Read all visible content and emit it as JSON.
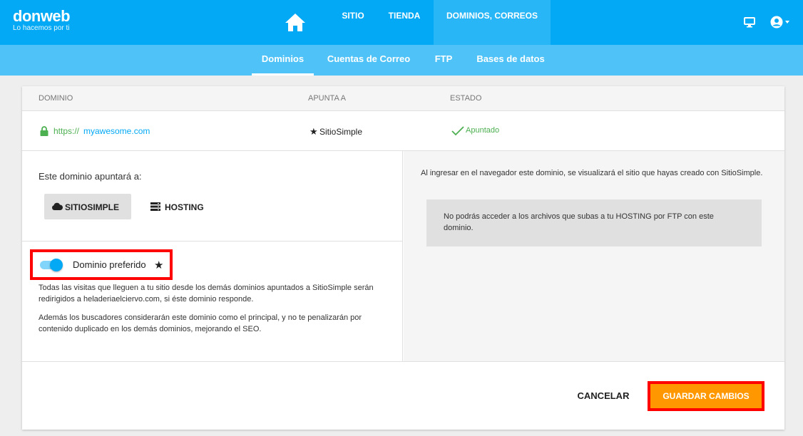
{
  "brand": {
    "name": "donweb",
    "tagline": "Lo hacemos por ti"
  },
  "nav": {
    "items": [
      {
        "label": "SITIO"
      },
      {
        "label": "TIENDA"
      },
      {
        "label": "DOMINIOS, CORREOS",
        "active": true
      }
    ],
    "icons": [
      "home-icon",
      "monitor-icon",
      "user-icon",
      "caret-down-icon"
    ]
  },
  "subnav": {
    "tabs": [
      {
        "label": "Dominios",
        "active": true
      },
      {
        "label": "Cuentas de Correo"
      },
      {
        "label": "FTP"
      },
      {
        "label": "Bases de datos"
      }
    ]
  },
  "table": {
    "headers": {
      "dominio": "DOMINIO",
      "apunta": "APUNTA A",
      "estado": "ESTADO"
    },
    "row": {
      "prefix": "https://",
      "domain": "myawesome.com",
      "apunta": "SitioSimple",
      "estado": "Apuntado"
    }
  },
  "panel": {
    "heading": "Este dominio apuntará a:",
    "options": {
      "sitiosimple": "SITIOSIMPLE",
      "hosting": "HOSTING"
    },
    "preferred_label": "Dominio preferido",
    "preferred_on": true,
    "desc1": "Todas las visitas que lleguen a tu sitio desde los demás dominios apuntados a SitioSimple serán redirigidos a heladeriaelciervo.com, si éste dominio responde.",
    "desc2": "Además los buscadores considerarán este dominio como el principal, y no te penalizarán por contenido duplicado en los demás dominios, mejorando el SEO.",
    "right_text": "Al ingresar en el navegador este dominio, se visualizará el sitio que hayas creado con SitioSimple.",
    "info": "No podrás acceder a los archivos que subas a tu HOSTING por FTP con este dominio."
  },
  "footer": {
    "cancel": "CANCELAR",
    "save": "GUARDAR CAMBIOS"
  },
  "colors": {
    "primary": "#03a9f4",
    "subnav": "#4fc3f7",
    "accent": "#ff9800",
    "success": "#4caf50",
    "highlight": "#ff0000"
  }
}
